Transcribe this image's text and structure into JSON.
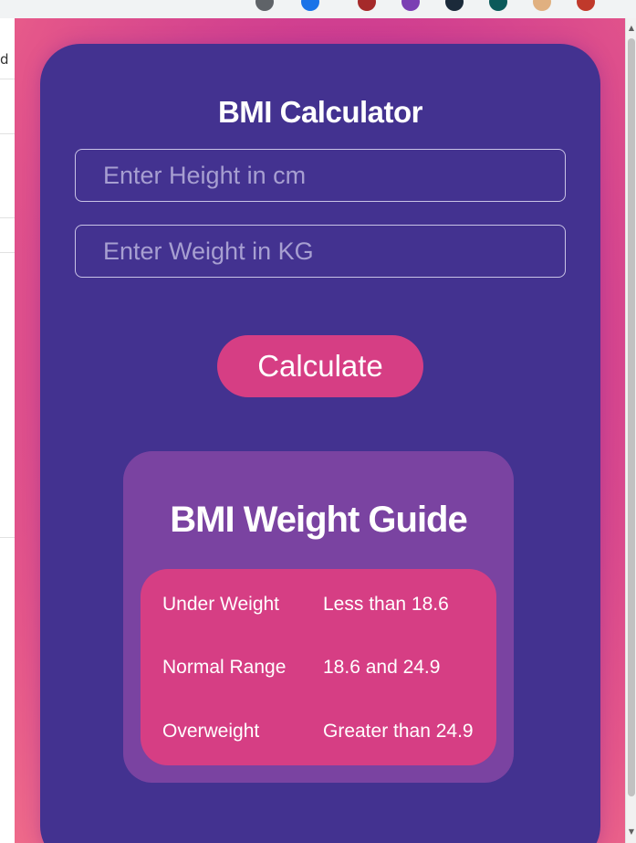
{
  "app": {
    "title": "BMI Calculator"
  },
  "form": {
    "height_placeholder": "Enter Height in cm",
    "height_value": "",
    "weight_placeholder": "Enter Weight in KG",
    "weight_value": "",
    "calculate_label": "Calculate"
  },
  "guide": {
    "title": "BMI Weight Guide",
    "rows": [
      {
        "category": "Under Weight",
        "range": "Less than 18.6"
      },
      {
        "category": "Normal Range",
        "range": "18.6 and 24.9"
      },
      {
        "category": "Overweight",
        "range": "Greater than 24.9"
      }
    ]
  },
  "browser": {
    "left_fragment": "d"
  },
  "colors": {
    "card": "#433290",
    "guide_panel": "#7a43a1",
    "accent": "#d63e84"
  }
}
